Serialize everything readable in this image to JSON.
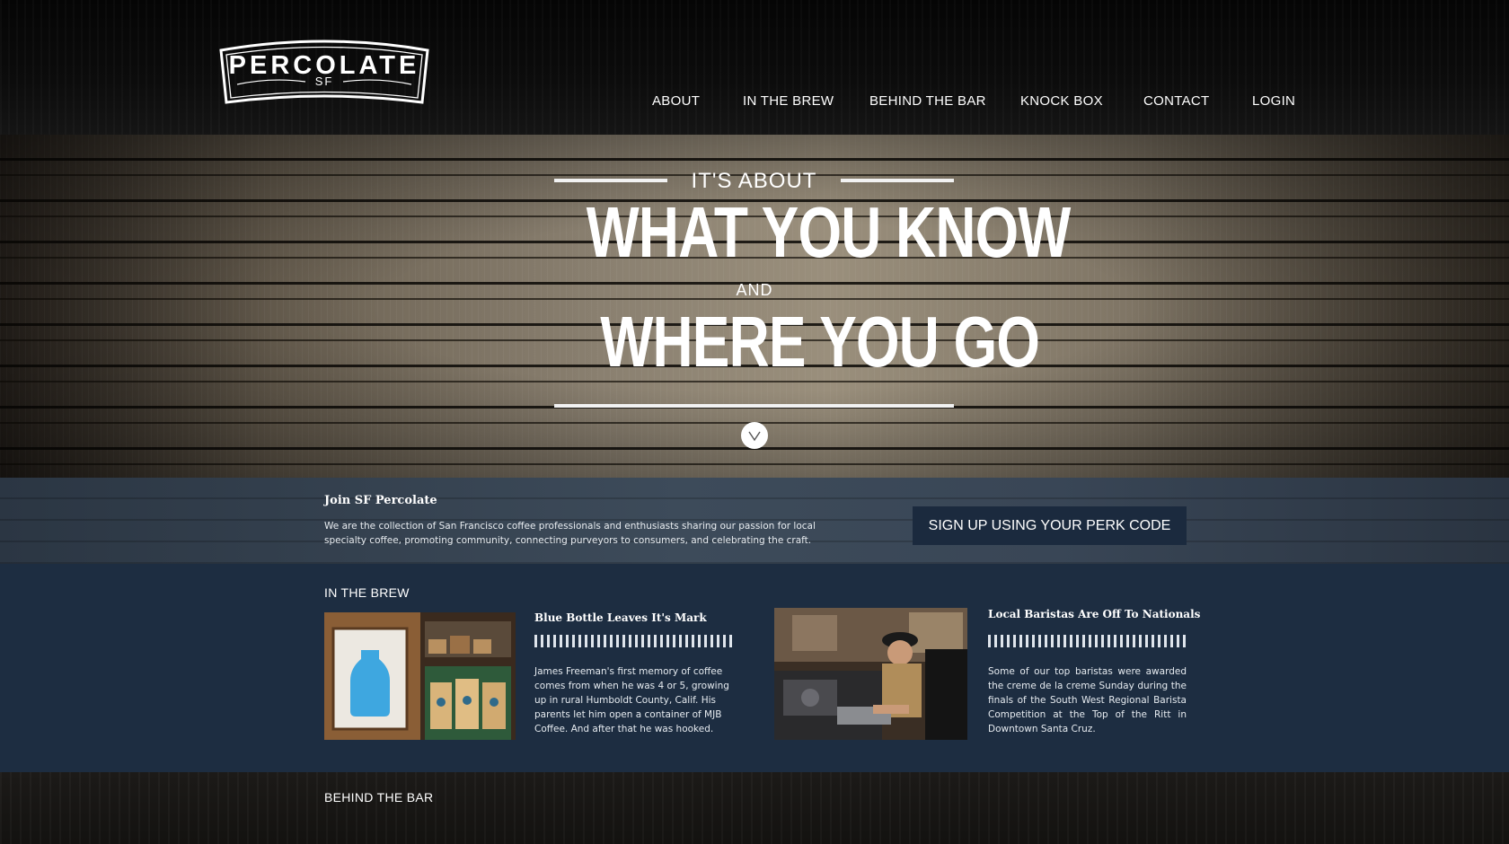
{
  "brand": {
    "name": "PERCOLATE",
    "sub": "SF"
  },
  "nav": {
    "items": [
      {
        "label": "ABOUT"
      },
      {
        "label": "IN THE BREW"
      },
      {
        "label": "BEHIND THE BAR"
      },
      {
        "label": "KNOCK BOX"
      },
      {
        "label": "CONTACT"
      },
      {
        "label": "LOGIN"
      }
    ]
  },
  "hero": {
    "line1": "IT'S ABOUT",
    "line2": "WHAT YOU KNOW",
    "line3": "AND",
    "line4": "WHERE YOU GO",
    "scroll_icon": "chevron-down-icon"
  },
  "join": {
    "title": "Join SF Percolate",
    "text": "We are the collection of San Francisco coffee professionals and enthusiasts sharing our passion for local specialty coffee, promoting community, connecting purveyors to consumers, and celebrating the craft.",
    "button": "SIGN UP USING YOUR PERK CODE"
  },
  "brew": {
    "heading": "IN THE BREW",
    "articles": [
      {
        "title": "Blue Bottle Leaves It's Mark",
        "text": "James Freeman's first memory of coffee comes from when he was 4 or 5, growing up in rural Humboldt County, Calif. His parents let him open a container of MJB Coffee. And after that he was hooked."
      },
      {
        "title": "Local Baristas Are Off To Nationals",
        "text": "Some of our top baristas were awarded the creme de la creme Sunday during the finals of the South West Regional Barista Competition at the Top of the Ritt in Downtown Santa Cruz."
      }
    ]
  },
  "behind_bar": {
    "heading": "BEHIND THE BAR"
  },
  "colors": {
    "navy": "#1d2d41",
    "button": "#1b2a3e",
    "slate": "#3d4b5a"
  }
}
